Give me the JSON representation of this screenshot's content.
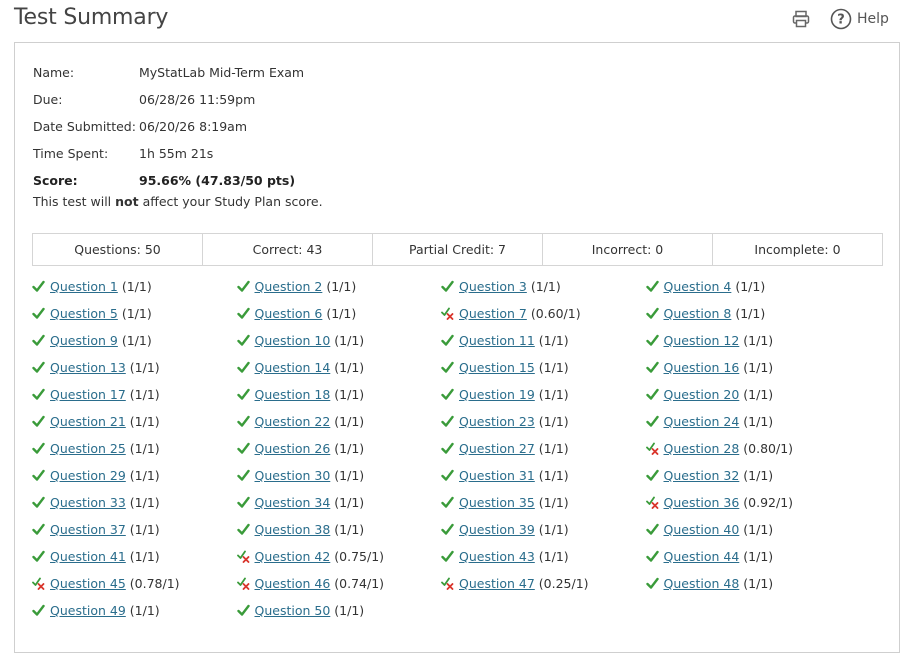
{
  "header": {
    "title": "Test Summary",
    "help_label": "Help"
  },
  "info": {
    "name_label": "Name:",
    "name_value": "MyStatLab Mid-Term Exam",
    "due_label": "Due:",
    "due_value": "06/28/26 11:59pm",
    "submitted_label": "Date Submitted:",
    "submitted_value": "06/20/26 8:19am",
    "time_label": "Time Spent:",
    "time_value": "1h 55m 21s",
    "score_label": "Score:",
    "score_value": "95.66% (47.83/50 pts)",
    "note_prefix": "This test will ",
    "note_bold": "not",
    "note_suffix": " affect your Study Plan score."
  },
  "stats": {
    "questions": "Questions: 50",
    "correct": "Correct: 43",
    "partial": "Partial Credit: 7",
    "incorrect": "Incorrect: 0",
    "incomplete": "Incomplete: 0"
  },
  "colors": {
    "correct_check": "#3a9b3a",
    "partial_x": "#d9342b",
    "link": "#2a6d8c"
  },
  "questions": [
    {
      "label": "Question 1",
      "score": "(1/1)",
      "status": "correct"
    },
    {
      "label": "Question 2",
      "score": "(1/1)",
      "status": "correct"
    },
    {
      "label": "Question 3",
      "score": "(1/1)",
      "status": "correct"
    },
    {
      "label": "Question 4",
      "score": "(1/1)",
      "status": "correct"
    },
    {
      "label": "Question 5",
      "score": "(1/1)",
      "status": "correct"
    },
    {
      "label": "Question 6",
      "score": "(1/1)",
      "status": "correct"
    },
    {
      "label": "Question 7",
      "score": "(0.60/1)",
      "status": "partial"
    },
    {
      "label": "Question 8",
      "score": "(1/1)",
      "status": "correct"
    },
    {
      "label": "Question 9",
      "score": "(1/1)",
      "status": "correct"
    },
    {
      "label": "Question 10",
      "score": "(1/1)",
      "status": "correct"
    },
    {
      "label": "Question 11",
      "score": "(1/1)",
      "status": "correct"
    },
    {
      "label": "Question 12",
      "score": "(1/1)",
      "status": "correct"
    },
    {
      "label": "Question 13",
      "score": "(1/1)",
      "status": "correct"
    },
    {
      "label": "Question 14",
      "score": "(1/1)",
      "status": "correct"
    },
    {
      "label": "Question 15",
      "score": "(1/1)",
      "status": "correct"
    },
    {
      "label": "Question 16",
      "score": "(1/1)",
      "status": "correct"
    },
    {
      "label": "Question 17",
      "score": "(1/1)",
      "status": "correct"
    },
    {
      "label": "Question 18",
      "score": "(1/1)",
      "status": "correct"
    },
    {
      "label": "Question 19",
      "score": "(1/1)",
      "status": "correct"
    },
    {
      "label": "Question 20",
      "score": "(1/1)",
      "status": "correct"
    },
    {
      "label": "Question 21",
      "score": "(1/1)",
      "status": "correct"
    },
    {
      "label": "Question 22",
      "score": "(1/1)",
      "status": "correct"
    },
    {
      "label": "Question 23",
      "score": "(1/1)",
      "status": "correct"
    },
    {
      "label": "Question 24",
      "score": "(1/1)",
      "status": "correct"
    },
    {
      "label": "Question 25",
      "score": "(1/1)",
      "status": "correct"
    },
    {
      "label": "Question 26",
      "score": "(1/1)",
      "status": "correct"
    },
    {
      "label": "Question 27",
      "score": "(1/1)",
      "status": "correct"
    },
    {
      "label": "Question 28",
      "score": "(0.80/1)",
      "status": "partial"
    },
    {
      "label": "Question 29",
      "score": "(1/1)",
      "status": "correct"
    },
    {
      "label": "Question 30",
      "score": "(1/1)",
      "status": "correct"
    },
    {
      "label": "Question 31",
      "score": "(1/1)",
      "status": "correct"
    },
    {
      "label": "Question 32",
      "score": "(1/1)",
      "status": "correct"
    },
    {
      "label": "Question 33",
      "score": "(1/1)",
      "status": "correct"
    },
    {
      "label": "Question 34",
      "score": "(1/1)",
      "status": "correct"
    },
    {
      "label": "Question 35",
      "score": "(1/1)",
      "status": "correct"
    },
    {
      "label": "Question 36",
      "score": "(0.92/1)",
      "status": "partial"
    },
    {
      "label": "Question 37",
      "score": "(1/1)",
      "status": "correct"
    },
    {
      "label": "Question 38",
      "score": "(1/1)",
      "status": "correct"
    },
    {
      "label": "Question 39",
      "score": "(1/1)",
      "status": "correct"
    },
    {
      "label": "Question 40",
      "score": "(1/1)",
      "status": "correct"
    },
    {
      "label": "Question 41",
      "score": "(1/1)",
      "status": "correct"
    },
    {
      "label": "Question 42",
      "score": "(0.75/1)",
      "status": "partial"
    },
    {
      "label": "Question 43",
      "score": "(1/1)",
      "status": "correct"
    },
    {
      "label": "Question 44",
      "score": "(1/1)",
      "status": "correct"
    },
    {
      "label": "Question 45",
      "score": "(0.78/1)",
      "status": "partial"
    },
    {
      "label": "Question 46",
      "score": "(0.74/1)",
      "status": "partial"
    },
    {
      "label": "Question 47",
      "score": "(0.25/1)",
      "status": "partial"
    },
    {
      "label": "Question 48",
      "score": "(1/1)",
      "status": "correct"
    },
    {
      "label": "Question 49",
      "score": "(1/1)",
      "status": "correct"
    },
    {
      "label": "Question 50",
      "score": "(1/1)",
      "status": "correct"
    }
  ]
}
